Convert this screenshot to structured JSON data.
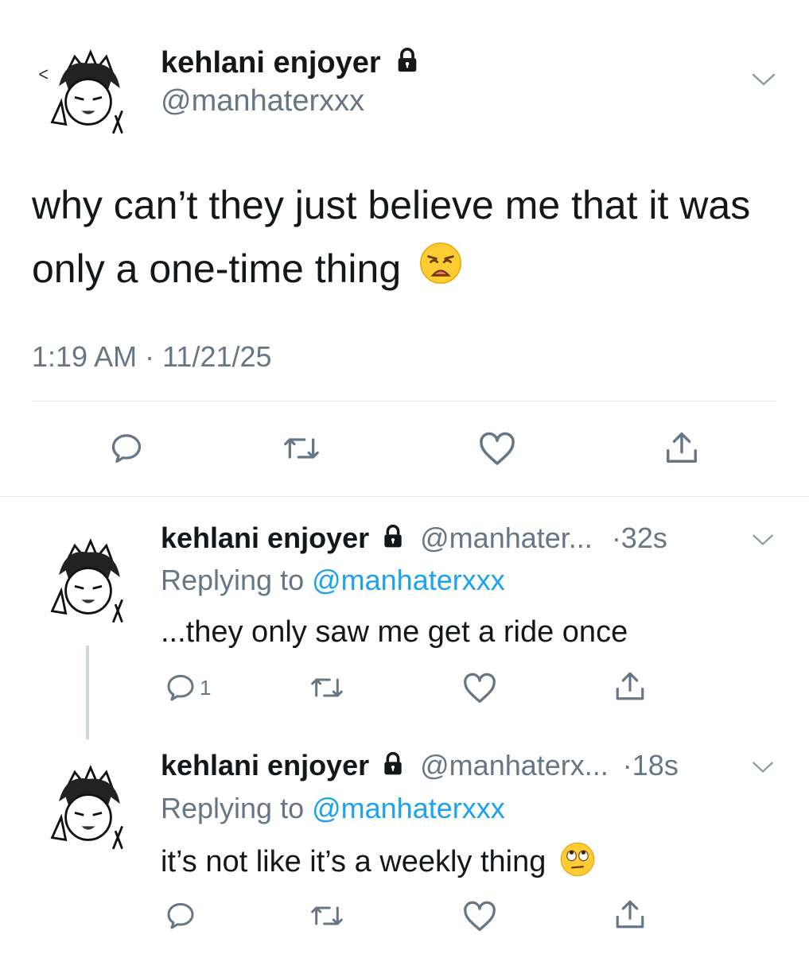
{
  "main_tweet": {
    "display_name": "kehlani enjoyer",
    "handle": "@manhaterxxx",
    "text": "why can’t they just believe me that it was only a one-time thing",
    "emoji": "weary-face-emoji",
    "timestamp": "1:19 AM · 11/21/25"
  },
  "replies": [
    {
      "display_name": "kehlani enjoyer",
      "handle": "@manhater...",
      "time": "·32s",
      "replying_prefix": "Replying to ",
      "replying_to": "@manhaterxxx",
      "text": "...they only saw me get a ride once",
      "reply_count": "1"
    },
    {
      "display_name": "kehlani enjoyer",
      "handle": "@manhaterx...",
      "time": "·18s",
      "replying_prefix": "Replying to ",
      "replying_to": "@manhaterxxx",
      "text": "it’s not like it’s a weekly thing",
      "emoji": "eye-roll-emoji"
    }
  ],
  "colors": {
    "text": "#14171a",
    "muted": "#657786",
    "link": "#1da1f2",
    "divider": "#e1e8ed"
  },
  "icons": [
    "chevron-down-icon",
    "lock-icon",
    "reply-icon",
    "retweet-icon",
    "like-icon",
    "share-icon"
  ]
}
